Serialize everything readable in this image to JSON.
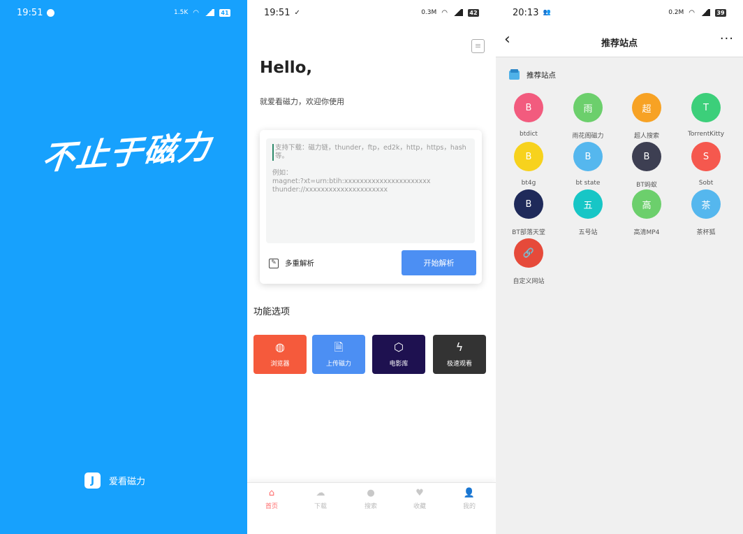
{
  "screen1": {
    "time": "19:51",
    "net_speed": "1.5K",
    "battery": "41",
    "slogan": "不止于磁力",
    "app_logo": "J",
    "app_name": "爱看磁力",
    "colors": {
      "background": "#17a1fd"
    }
  },
  "screen2": {
    "time": "19:51",
    "net_speed": "0.3M",
    "battery": "42",
    "greeting": "Hello,",
    "welcome": "就爱看磁力，欢迎你使用",
    "input": {
      "placeholder": "支持下载：磁力链，thunder，ftp，ed2k，http，https，hash等。",
      "example_label": "例如：",
      "example_1": "magnet:?xt=urn:btih:xxxxxxxxxxxxxxxxxxxxxx",
      "example_2": "thunder://xxxxxxxxxxxxxxxxxxxxx"
    },
    "multi_parse": "多重解析",
    "start_button": "开始解析",
    "features_title": "功能选项",
    "features": [
      {
        "label": "浏览器",
        "icon": "globe-icon",
        "color": "#f55a3c"
      },
      {
        "label": "上传磁力",
        "icon": "upload-file-icon",
        "color": "#4c8ff3"
      },
      {
        "label": "电影库",
        "icon": "cube-icon",
        "color": "#1e1150"
      },
      {
        "label": "极速观看",
        "icon": "lightning-icon",
        "color": "#333333"
      }
    ],
    "tabs": [
      {
        "label": "首页",
        "icon": "home-icon"
      },
      {
        "label": "下载",
        "icon": "download-icon"
      },
      {
        "label": "搜索",
        "icon": "search-icon"
      },
      {
        "label": "收藏",
        "icon": "heart-icon"
      },
      {
        "label": "我的",
        "icon": "user-icon"
      }
    ],
    "colors": {
      "accent": "#4c8ff3",
      "active_tab": "#ff6b6b"
    }
  },
  "screen3": {
    "time": "20:13",
    "net_speed": "0.2M",
    "battery": "39",
    "title": "推荐站点",
    "section_title": "推荐站点",
    "sites": [
      {
        "letter": "B",
        "name": "btdict",
        "color": "#f25b7e"
      },
      {
        "letter": "雨",
        "name": "雨花阁磁力",
        "color": "#6ccf6c"
      },
      {
        "letter": "超",
        "name": "超人搜索",
        "color": "#f7a224"
      },
      {
        "letter": "T",
        "name": "TorrentKitty",
        "color": "#3ccf7a"
      },
      {
        "letter": "B",
        "name": "bt4g",
        "color": "#f7d21d"
      },
      {
        "letter": "B",
        "name": "bt state",
        "color": "#55b7ee"
      },
      {
        "letter": "B",
        "name": "BT蚂蚁",
        "color": "#3d3f52"
      },
      {
        "letter": "S",
        "name": "Sobt",
        "color": "#f5584e"
      },
      {
        "letter": "B",
        "name": "BT部落天堂",
        "color": "#1f2a5a"
      },
      {
        "letter": "五",
        "name": "五号站",
        "color": "#17c6c6"
      },
      {
        "letter": "高",
        "name": "高清MP4",
        "color": "#6ccf6c"
      },
      {
        "letter": "茶",
        "name": "茶杯狐",
        "color": "#55b7ee"
      },
      {
        "letter": "🔗",
        "name": "自定义网站",
        "color": "#e64a3a"
      }
    ]
  }
}
